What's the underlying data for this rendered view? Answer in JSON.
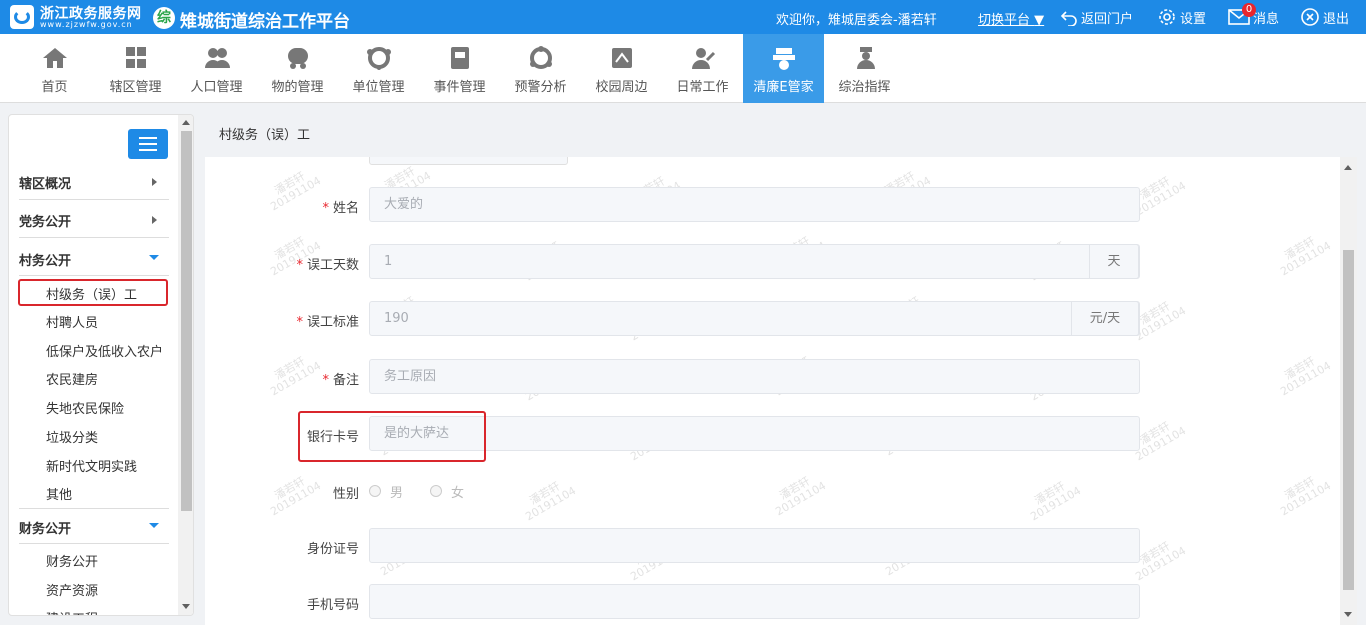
{
  "header": {
    "logo_title": "浙江政务服务网",
    "logo_sub": "www.zjzwfw.gov.cn",
    "platform_icon_text": "综",
    "platform_title": "雉城街道综治工作平台",
    "welcome": "欢迎你，雉城居委会-潘若轩",
    "switch_platform": "切换平台",
    "back_portal": "返回门户",
    "settings": "设置",
    "messages": "消息",
    "message_count": "0",
    "logout": "退出"
  },
  "nav": {
    "items": [
      {
        "label": "首页",
        "icon": "home-icon"
      },
      {
        "label": "辖区管理",
        "icon": "grid-icon"
      },
      {
        "label": "人口管理",
        "icon": "people-icon"
      },
      {
        "label": "物的管理",
        "icon": "item-icon"
      },
      {
        "label": "单位管理",
        "icon": "org-icon"
      },
      {
        "label": "事件管理",
        "icon": "event-icon"
      },
      {
        "label": "预警分析",
        "icon": "warning-icon"
      },
      {
        "label": "校园周边",
        "icon": "campus-icon"
      },
      {
        "label": "日常工作",
        "icon": "daily-work-icon"
      },
      {
        "label": "清廉E管家",
        "icon": "butler-icon",
        "active": true
      },
      {
        "label": "综治指挥",
        "icon": "command-icon"
      }
    ]
  },
  "sidebar": {
    "sections": [
      {
        "label": "辖区概况"
      },
      {
        "label": "党务公开"
      },
      {
        "label": "村务公开"
      },
      {
        "label": "财务公开"
      }
    ],
    "village_items": [
      "村级务（误）工",
      "村聘人员",
      "低保户及低收入农户",
      "农民建房",
      "失地农民保险",
      "垃圾分类",
      "新时代文明实践",
      "其他"
    ],
    "finance_items": [
      "财务公开",
      "资产资源",
      "建设工程"
    ]
  },
  "breadcrumb": "村级务（误）工",
  "form": {
    "name_label": "姓名",
    "name_value": "大爱的",
    "days_label": "误工天数",
    "days_value": "1",
    "days_unit": "天",
    "standard_label": "误工标准",
    "standard_value": "190",
    "standard_unit": "元/天",
    "remark_label": "备注",
    "remark_value": "务工原因",
    "bank_label": "银行卡号",
    "bank_value": "是的大萨达",
    "gender_label": "性别",
    "gender_male": "男",
    "gender_female": "女",
    "id_label": "身份证号",
    "id_value": "",
    "phone_label": "手机号码",
    "phone_value": ""
  },
  "watermark": {
    "name": "潘若轩",
    "date": "20191104"
  }
}
